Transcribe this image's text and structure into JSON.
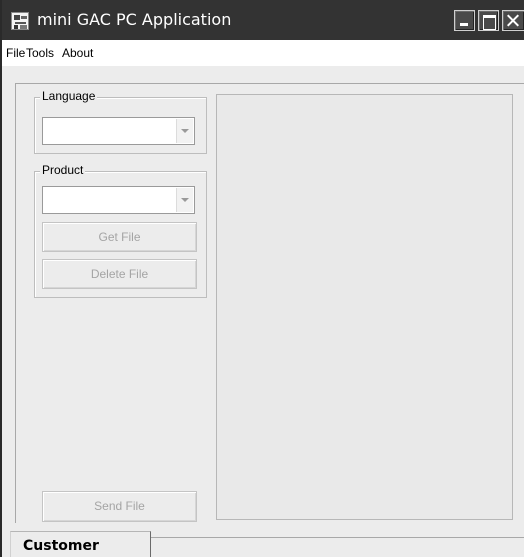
{
  "window": {
    "title": "mini GAC PC Application",
    "icon": "gac-app-icon",
    "controls": {
      "minimize_icon": "minimize-icon",
      "maximize_icon": "maximize-icon",
      "close_icon": "close-icon"
    }
  },
  "menu": {
    "items": [
      {
        "label": "File"
      },
      {
        "label": "Tools"
      },
      {
        "label": "About"
      }
    ]
  },
  "language_group": {
    "label": "Language",
    "selected": ""
  },
  "product_group": {
    "label": "Product",
    "selected": "",
    "get_file_label": "Get File",
    "delete_file_label": "Delete File"
  },
  "send_file_label": "Send File",
  "tabs": [
    {
      "label": "Customer",
      "active": true
    }
  ],
  "colors": {
    "titlebar": "#333333",
    "window_bg": "#ececec",
    "disabled_text": "#a4a4a4"
  }
}
